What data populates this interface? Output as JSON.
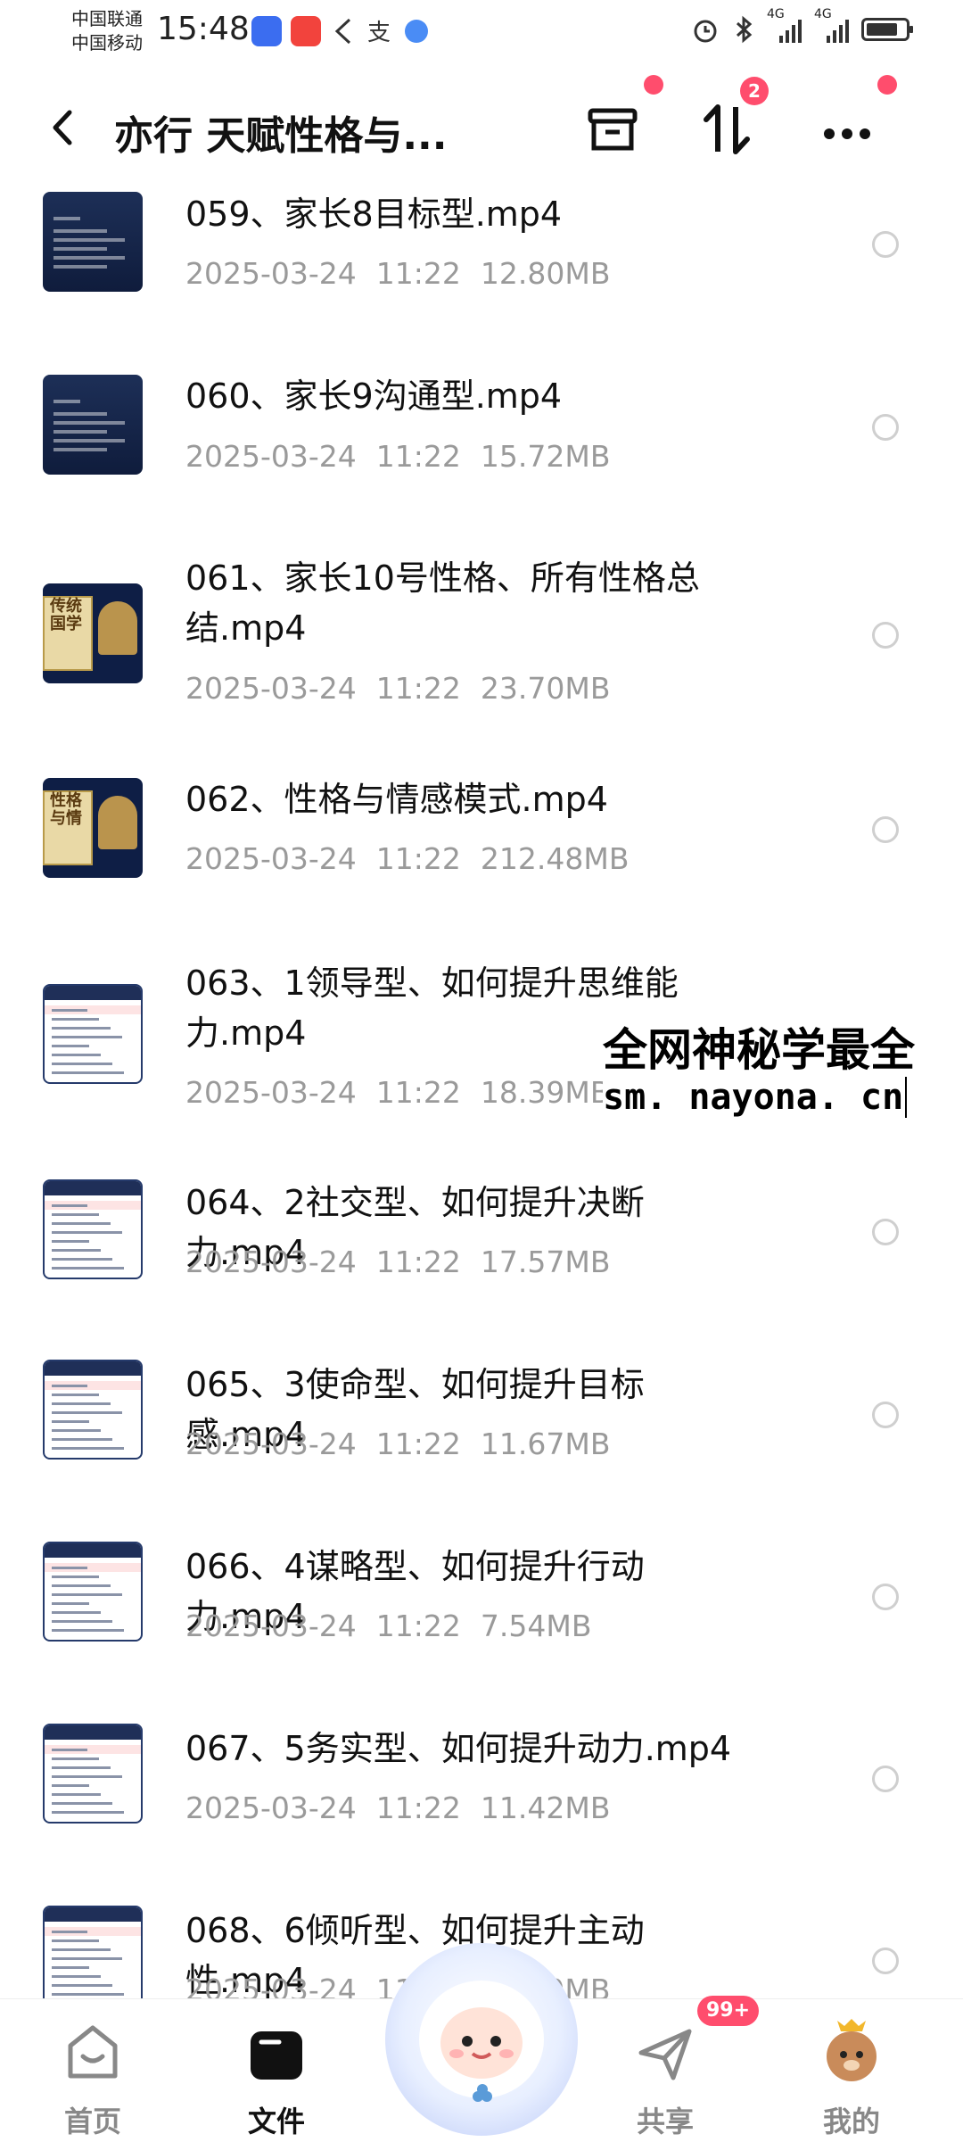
{
  "status_bar": {
    "carrier1": "中国联通",
    "carrier2": "中国移动",
    "time": "15:48",
    "network1": "4G",
    "network2": "4G"
  },
  "header": {
    "title": "亦行 天赋性格与..."
  },
  "sort_badge": "2",
  "files": [
    {
      "name": "059、家长8目标型.mp4",
      "date": "2025-03-24",
      "time": "11:22",
      "size": "12.80MB",
      "thumb": "dark"
    },
    {
      "name": "060、家长9沟通型.mp4",
      "date": "2025-03-24",
      "time": "11:22",
      "size": "15.72MB",
      "thumb": "dark"
    },
    {
      "name": "061、家长10号性格、所有性格总结.mp4",
      "date": "2025-03-24",
      "time": "11:22",
      "size": "23.70MB",
      "thumb": "gold"
    },
    {
      "name": "062、性格与情感模式.mp4",
      "date": "2025-03-24",
      "time": "11:22",
      "size": "212.48MB",
      "thumb": "gold"
    },
    {
      "name": "063、1领导型、如何提升思维能力.mp4",
      "date": "2025-03-24",
      "time": "11:22",
      "size": "18.39MB",
      "thumb": "doc"
    },
    {
      "name": "064、2社交型、如何提升决断力.mp4",
      "date": "2025-03-24",
      "time": "11:22",
      "size": "17.57MB",
      "thumb": "doc"
    },
    {
      "name": "065、3使命型、如何提升目标感.mp4",
      "date": "2025-03-24",
      "time": "11:22",
      "size": "11.67MB",
      "thumb": "doc"
    },
    {
      "name": "066、4谋略型、如何提升行动力.mp4",
      "date": "2025-03-24",
      "time": "11:22",
      "size": "7.54MB",
      "thumb": "doc"
    },
    {
      "name": "067、5务实型、如何提升动力.mp4",
      "date": "2025-03-24",
      "time": "11:22",
      "size": "11.42MB",
      "thumb": "doc"
    },
    {
      "name": "068、6倾听型、如何提升主动性.mp4",
      "date": "2025-03-24",
      "time": "11:22",
      "size": "11.19MB",
      "thumb": "doc"
    }
  ],
  "thumb_text": {
    "t061": [
      "传统",
      "国学"
    ],
    "t062": [
      "性格",
      "与情"
    ]
  },
  "watermark": {
    "line1": "全网神秘学最全",
    "line2": "sm. nayona. cn"
  },
  "nav": {
    "home": "首页",
    "files": "文件",
    "share": "共享",
    "mine": "我的",
    "share_badge": "99+"
  },
  "colors": {
    "accent_badge": "#ff4d6d",
    "meta_gray": "#9a9a9a"
  }
}
